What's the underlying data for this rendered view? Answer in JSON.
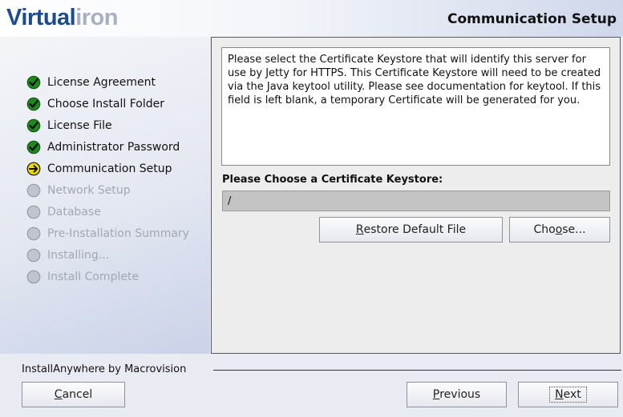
{
  "header": {
    "logo_part1": "Virtual",
    "logo_part2": "iron",
    "step_title": "Communication Setup"
  },
  "steps": [
    {
      "label": "License Agreement",
      "state": "done"
    },
    {
      "label": "Choose Install Folder",
      "state": "done"
    },
    {
      "label": "License File",
      "state": "done"
    },
    {
      "label": "Administrator Password",
      "state": "done"
    },
    {
      "label": "Communication Setup",
      "state": "current"
    },
    {
      "label": "Network Setup",
      "state": "pending"
    },
    {
      "label": "Database",
      "state": "pending"
    },
    {
      "label": "Pre-Installation Summary",
      "state": "pending"
    },
    {
      "label": "Installing...",
      "state": "pending"
    },
    {
      "label": "Install Complete",
      "state": "pending"
    }
  ],
  "main": {
    "description": "Please select the Certificate Keystore that will identify this server for use by Jetty for HTTPS.  This Certificate Keystore will need to be created via the Java keytool utility.  Please see documentation for keytool.  If this field is left blank, a temporary Certificate will be generated for you.",
    "field_label": "Please Choose a Certificate Keystore:",
    "field_value": "/",
    "restore_label_mnemonic": "R",
    "restore_label_rest": "estore Default File",
    "choose_label_pre": "Cho",
    "choose_label_mnemonic": "o",
    "choose_label_rest": "se..."
  },
  "footer": {
    "vendor": "InstallAnywhere by Macrovision",
    "cancel_mnemonic": "C",
    "cancel_rest": "ancel",
    "previous_mnemonic": "P",
    "previous_rest": "revious",
    "next_mnemonic": "N",
    "next_rest": "ext"
  },
  "colors": {
    "done": "#1c8a1c",
    "current": "#f2d800",
    "pending": "#c0c4cc"
  }
}
